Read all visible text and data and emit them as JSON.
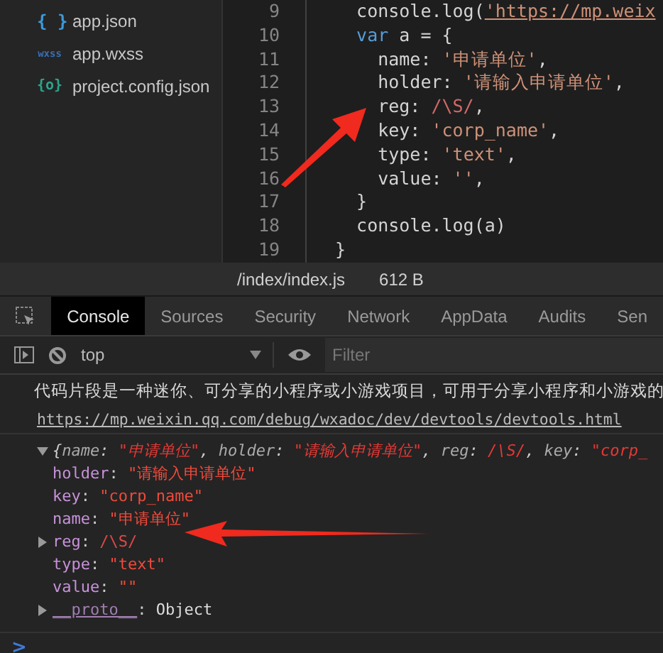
{
  "sidebar": {
    "files": [
      {
        "kind": "json",
        "badge": "{ }",
        "name": "app.json"
      },
      {
        "kind": "wxss",
        "badge": "wxss",
        "name": "app.wxss"
      },
      {
        "kind": "config",
        "badge": "{o}",
        "name": "project.config.json"
      }
    ]
  },
  "editor": {
    "lines": [
      {
        "number": "9",
        "tokens": [
          {
            "kind": "plain",
            "text": "  console.log("
          },
          {
            "kind": "link",
            "text": "'https://mp.weix"
          }
        ]
      },
      {
        "number": "10",
        "tokens": [
          {
            "kind": "keyword",
            "text": "  var"
          },
          {
            "kind": "plain",
            "text": " a = {"
          }
        ]
      },
      {
        "number": "11",
        "tokens": [
          {
            "kind": "plain",
            "text": "    name: "
          },
          {
            "kind": "string",
            "text": "'申请单位'"
          },
          {
            "kind": "plain",
            "text": ","
          }
        ]
      },
      {
        "number": "12",
        "tokens": [
          {
            "kind": "plain",
            "text": "    holder: "
          },
          {
            "kind": "string",
            "text": "'请输入申请单位'"
          },
          {
            "kind": "plain",
            "text": ","
          }
        ]
      },
      {
        "number": "13",
        "tokens": [
          {
            "kind": "plain",
            "text": "    reg: "
          },
          {
            "kind": "regex",
            "text": "/\\S/"
          },
          {
            "kind": "plain",
            "text": ","
          }
        ]
      },
      {
        "number": "14",
        "tokens": [
          {
            "kind": "plain",
            "text": "    key: "
          },
          {
            "kind": "string",
            "text": "'corp_name'"
          },
          {
            "kind": "plain",
            "text": ","
          }
        ]
      },
      {
        "number": "15",
        "tokens": [
          {
            "kind": "plain",
            "text": "    type: "
          },
          {
            "kind": "string",
            "text": "'text'"
          },
          {
            "kind": "plain",
            "text": ","
          }
        ]
      },
      {
        "number": "16",
        "tokens": [
          {
            "kind": "plain",
            "text": "    value: "
          },
          {
            "kind": "string",
            "text": "''"
          },
          {
            "kind": "plain",
            "text": ","
          }
        ]
      },
      {
        "number": "17",
        "tokens": [
          {
            "kind": "plain",
            "text": "  }"
          }
        ]
      },
      {
        "number": "18",
        "tokens": [
          {
            "kind": "plain",
            "text": "  console.log(a)"
          }
        ]
      },
      {
        "number": "19",
        "tokens": [
          {
            "kind": "plain",
            "text": "}"
          }
        ]
      }
    ]
  },
  "status_bar": {
    "path": "/index/index.js",
    "size": "612 B"
  },
  "devtools": {
    "tabs": [
      {
        "label": "Console",
        "selected": true
      },
      {
        "label": "Sources",
        "selected": false
      },
      {
        "label": "Security",
        "selected": false
      },
      {
        "label": "Network",
        "selected": false
      },
      {
        "label": "AppData",
        "selected": false
      },
      {
        "label": "Audits",
        "selected": false
      },
      {
        "label": "Sen",
        "selected": false
      }
    ],
    "context": "top",
    "filter": {
      "placeholder": "Filter"
    }
  },
  "console": {
    "message": "代码片段是一种迷你、可分享的小程序或小游戏项目，可用于分享小程序和小游戏的",
    "link": "https://mp.weixin.qq.com/debug/wxadoc/dev/devtools/devtools.html",
    "object": {
      "expanded": true,
      "summary": [
        {
          "kind": "punct",
          "text": "{"
        },
        {
          "kind": "key",
          "text": "name"
        },
        {
          "kind": "punct",
          "text": ": "
        },
        {
          "kind": "string",
          "text": "\"申请单位\""
        },
        {
          "kind": "punct",
          "text": ", "
        },
        {
          "kind": "key",
          "text": "holder"
        },
        {
          "kind": "punct",
          "text": ": "
        },
        {
          "kind": "string",
          "text": "\"请输入申请单位\""
        },
        {
          "kind": "punct",
          "text": ", "
        },
        {
          "kind": "key",
          "text": "reg"
        },
        {
          "kind": "punct",
          "text": ": "
        },
        {
          "kind": "string",
          "text": "/\\S/"
        },
        {
          "kind": "punct",
          "text": ", "
        },
        {
          "kind": "key",
          "text": "key"
        },
        {
          "kind": "punct",
          "text": ": "
        },
        {
          "kind": "string",
          "text": "\"corp_"
        }
      ],
      "properties": [
        {
          "key": "holder",
          "sep": ":",
          "value": "\"请输入申请单位\"",
          "kind": "string",
          "expandable": false
        },
        {
          "key": "key",
          "sep": ":",
          "value": "\"corp_name\"",
          "kind": "string",
          "expandable": false
        },
        {
          "key": "name",
          "sep": ":",
          "value": "\"申请单位\"",
          "kind": "string",
          "expandable": false
        },
        {
          "key": "reg",
          "sep": ":",
          "value": "/\\S/",
          "kind": "regex",
          "expandable": true
        },
        {
          "key": "type",
          "sep": ":",
          "value": "\"text\"",
          "kind": "string",
          "expandable": false
        },
        {
          "key": "value",
          "sep": ":",
          "value": "\"\"",
          "kind": "string",
          "expandable": false
        },
        {
          "key": "__proto__",
          "sep": ":",
          "value": "Object",
          "kind": "object",
          "expandable": true
        }
      ]
    },
    "prompt": ">"
  }
}
